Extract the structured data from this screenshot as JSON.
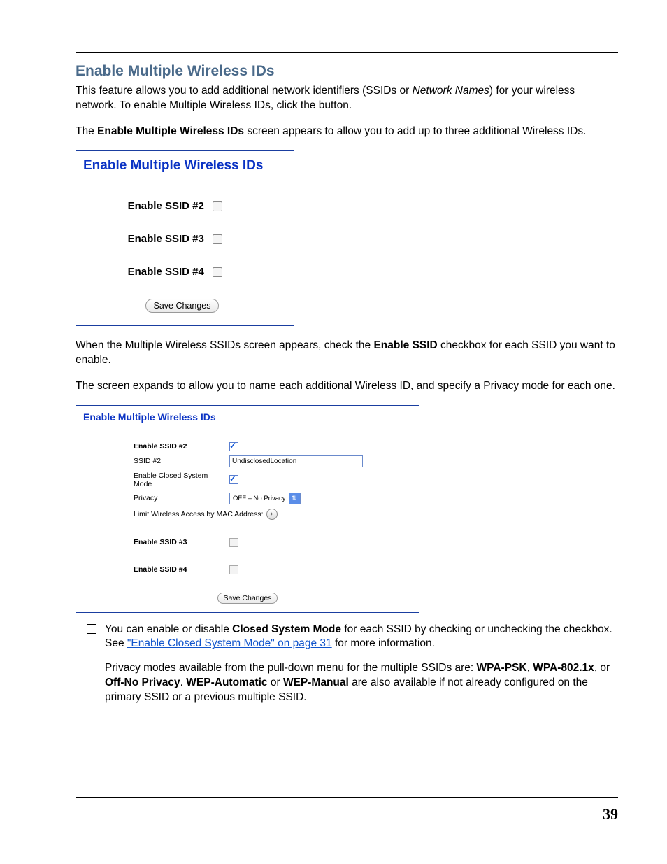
{
  "page_number": "39",
  "heading": "Enable Multiple Wireless IDs",
  "intro_1a": "This feature allows you to add additional network identifiers (SSIDs or ",
  "intro_1b_italic": "Network Names",
  "intro_1c": ") for your wireless network. To enable Multiple Wireless IDs, click the button.",
  "intro_2a": "The ",
  "intro_2b_bold": "Enable Multiple Wireless IDs",
  "intro_2c": " screen appears to allow you to add up to three additional Wireless IDs.",
  "panel1": {
    "title": "Enable Multiple Wireless IDs",
    "row2": "Enable SSID #2",
    "row3": "Enable SSID #3",
    "row4": "Enable SSID #4",
    "save": "Save Changes"
  },
  "mid_1a": "When the Multiple Wireless SSIDs screen appears, check the ",
  "mid_1b_bold": "Enable SSID",
  "mid_1c": " checkbox for each SSID you want to enable.",
  "mid_2": "The screen expands to allow you to name each additional Wireless ID, and specify a Privacy mode for each one.",
  "panel2": {
    "title": "Enable Multiple Wireless IDs",
    "r_enable2": "Enable SSID #2",
    "r_ssid2": "SSID #2",
    "ssid2_value": "UndisclosedLocation",
    "r_closed": "Enable Closed System Mode",
    "r_privacy": "Privacy",
    "privacy_value": "OFF – No Privacy",
    "r_mac": "Limit Wireless Access by MAC Address:",
    "r_enable3": "Enable SSID #3",
    "r_enable4": "Enable SSID #4",
    "save": "Save Changes"
  },
  "bullets": {
    "b1_a": "You can enable or disable ",
    "b1_bold": "Closed System Mode",
    "b1_b": " for each SSID by checking or unchecking the checkbox. See ",
    "b1_link": "\"Enable Closed System Mode\" on page 31",
    "b1_c": " for more information.",
    "b2_a": "Privacy modes available from the pull-down menu for the multiple SSIDs are: ",
    "b2_bold1": "WPA-PSK",
    "b2_sep1": ", ",
    "b2_bold2": "WPA-802.1x",
    "b2_sep2": ", or ",
    "b2_bold3": "Off-No Privacy",
    "b2_sep3": ". ",
    "b2_bold4": "WEP-Automatic",
    "b2_sep4": " or ",
    "b2_bold5": "WEP-Manual",
    "b2_b": " are also available if not already configured on the primary SSID or a previous multiple SSID."
  }
}
